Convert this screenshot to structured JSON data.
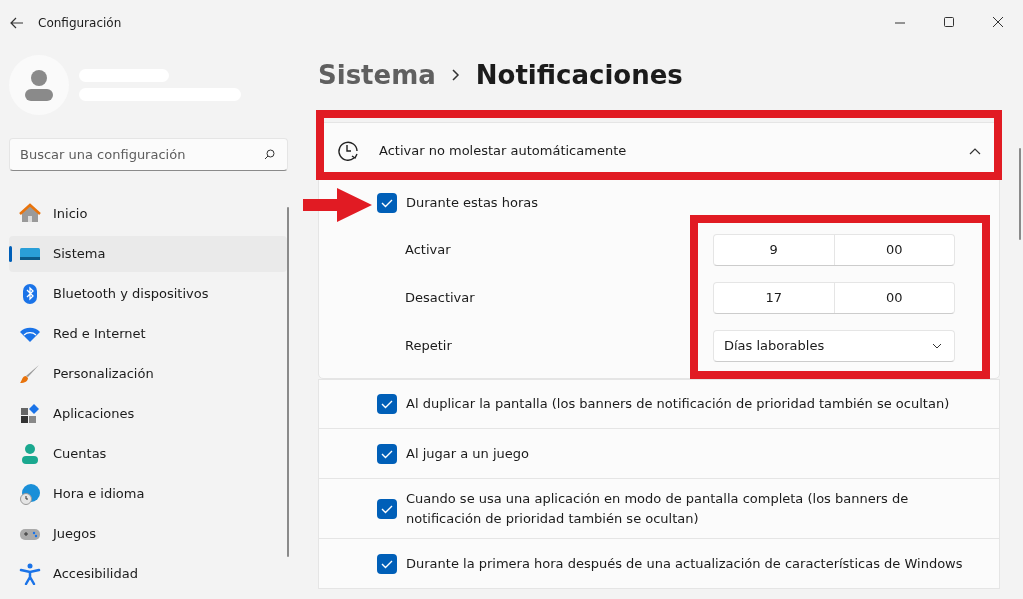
{
  "window": {
    "title": "Configuración"
  },
  "search": {
    "placeholder": "Buscar una configuración"
  },
  "sidebar": {
    "items": [
      {
        "label": "Inicio",
        "selected": false
      },
      {
        "label": "Sistema",
        "selected": true
      },
      {
        "label": "Bluetooth y dispositivos",
        "selected": false
      },
      {
        "label": "Red e Internet",
        "selected": false
      },
      {
        "label": "Personalización",
        "selected": false
      },
      {
        "label": "Aplicaciones",
        "selected": false
      },
      {
        "label": "Cuentas",
        "selected": false
      },
      {
        "label": "Hora e idioma",
        "selected": false
      },
      {
        "label": "Juegos",
        "selected": false
      },
      {
        "label": "Accesibilidad",
        "selected": false
      }
    ]
  },
  "breadcrumb": {
    "parent": "Sistema",
    "current": "Notificaciones"
  },
  "section": {
    "title": "Activar no molestar automáticamente",
    "expanded": true,
    "hours": {
      "label": "Durante estas horas",
      "checked": true
    },
    "times": [
      {
        "label": "Activar",
        "hour": "9",
        "minute": "00"
      },
      {
        "label": "Desactivar",
        "hour": "17",
        "minute": "00"
      }
    ],
    "repeat": {
      "label": "Repetir",
      "value": "Días laborables"
    }
  },
  "options": [
    {
      "label": "Al duplicar la pantalla (los banners de notificación de prioridad también se ocultan)",
      "checked": true
    },
    {
      "label": "Al jugar a un juego",
      "checked": true
    },
    {
      "label": "Cuando se usa una aplicación en modo de pantalla completa (los banners de notificación de prioridad también se ocultan)",
      "checked": true
    },
    {
      "label": "Durante la primera hora después de una actualización de características de Windows",
      "checked": true
    }
  ]
}
